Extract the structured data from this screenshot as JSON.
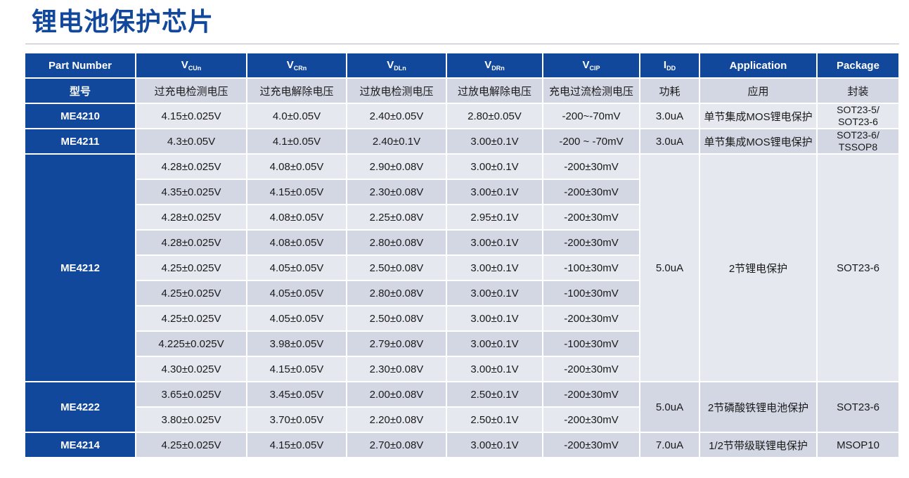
{
  "title": "锂电池保护芯片",
  "header": {
    "part_number": "Part Number",
    "vcun_main": "V",
    "vcun_sub": "CUn",
    "vcrn_main": "V",
    "vcrn_sub": "CRn",
    "vdln_main": "V",
    "vdln_sub": "DLn",
    "vdrn_main": "V",
    "vdrn_sub": "DRn",
    "vcip_main": "V",
    "vcip_sub": "CIP",
    "idd_main": "I",
    "idd_sub": "DD",
    "application": "Application",
    "package": "Package"
  },
  "header_cn": {
    "model": "型号",
    "vcun": "过充电检测电压",
    "vcrn": "过充电解除电压",
    "vdln": "过放电检测电压",
    "vdrn": "过放电解除电压",
    "vcip": "充电过流检测电压",
    "idd": "功耗",
    "application": "应用",
    "package": "封装"
  },
  "rows": [
    {
      "vcun": "4.15±0.025V",
      "vcrn": "4.0±0.05V",
      "vdln": "2.40±0.05V",
      "vdrn": "2.80±0.05V",
      "vcip": "-200~-70mV"
    },
    {
      "vcun": "4.3±0.05V",
      "vcrn": "4.1±0.05V",
      "vdln": "2.40±0.1V",
      "vdrn": "3.00±0.1V",
      "vcip": "-200 ~ -70mV"
    },
    {
      "vcun": "4.28±0.025V",
      "vcrn": "4.08±0.05V",
      "vdln": "2.90±0.08V",
      "vdrn": "3.00±0.1V",
      "vcip": "-200±30mV"
    },
    {
      "vcun": "4.35±0.025V",
      "vcrn": "4.15±0.05V",
      "vdln": "2.30±0.08V",
      "vdrn": "3.00±0.1V",
      "vcip": "-200±30mV"
    },
    {
      "vcun": "4.28±0.025V",
      "vcrn": "4.08±0.05V",
      "vdln": "2.25±0.08V",
      "vdrn": "2.95±0.1V",
      "vcip": "-200±30mV"
    },
    {
      "vcun": "4.28±0.025V",
      "vcrn": "4.08±0.05V",
      "vdln": "2.80±0.08V",
      "vdrn": "3.00±0.1V",
      "vcip": "-200±30mV"
    },
    {
      "vcun": "4.25±0.025V",
      "vcrn": "4.05±0.05V",
      "vdln": "2.50±0.08V",
      "vdrn": "3.00±0.1V",
      "vcip": "-100±30mV"
    },
    {
      "vcun": "4.25±0.025V",
      "vcrn": "4.05±0.05V",
      "vdln": "2.80±0.08V",
      "vdrn": "3.00±0.1V",
      "vcip": "-100±30mV"
    },
    {
      "vcun": "4.25±0.025V",
      "vcrn": "4.05±0.05V",
      "vdln": "2.50±0.08V",
      "vdrn": "3.00±0.1V",
      "vcip": "-200±30mV"
    },
    {
      "vcun": "4.225±0.025V",
      "vcrn": "3.98±0.05V",
      "vdln": "2.79±0.08V",
      "vdrn": "3.00±0.1V",
      "vcip": "-100±30mV"
    },
    {
      "vcun": "4.30±0.025V",
      "vcrn": "4.15±0.05V",
      "vdln": "2.30±0.08V",
      "vdrn": "3.00±0.1V",
      "vcip": "-200±30mV"
    },
    {
      "vcun": "3.65±0.025V",
      "vcrn": "3.45±0.05V",
      "vdln": "2.00±0.08V",
      "vdrn": "2.50±0.1V",
      "vcip": "-200±30mV"
    },
    {
      "vcun": "3.80±0.025V",
      "vcrn": "3.70±0.05V",
      "vdln": "2.20±0.08V",
      "vdrn": "2.50±0.1V",
      "vcip": "-200±30mV"
    },
    {
      "vcun": "4.25±0.025V",
      "vcrn": "4.15±0.05V",
      "vdln": "2.70±0.08V",
      "vdrn": "3.00±0.1V",
      "vcip": "-200±30mV"
    }
  ],
  "groups": {
    "me4210": {
      "part": "ME4210",
      "idd": "3.0uA",
      "application": "单节集成MOS锂电保护",
      "package_1": "SOT23-5/",
      "package_2": "SOT23-6"
    },
    "me4211": {
      "part": "ME4211",
      "idd": "3.0uA",
      "application": "单节集成MOS锂电保护",
      "package_1": "SOT23-6/",
      "package_2": "TSSOP8"
    },
    "me4212": {
      "part": "ME4212",
      "idd": "5.0uA",
      "application": "2节锂电保护",
      "package": "SOT23-6"
    },
    "me4222": {
      "part": "ME4222",
      "idd": "5.0uA",
      "application": "2节磷酸铁锂电池保护",
      "package": "SOT23-6"
    },
    "me4214": {
      "part": "ME4214",
      "idd": "7.0uA",
      "application": "1/2节带级联锂电保护",
      "package": "MSOP10"
    }
  }
}
